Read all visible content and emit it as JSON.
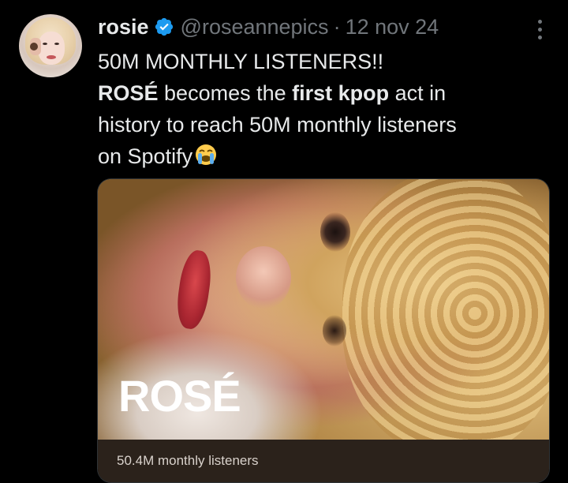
{
  "tweet": {
    "author_name": "rosie",
    "author_handle": "@roseannepics",
    "separator": "·",
    "date": "12 nov 24",
    "verified": true,
    "text_line1": "50M MONTHLY LISTENERS!!",
    "line2_bold1": "ROSÉ",
    "line2_mid": " becomes the ",
    "line2_bold2": "first kpop",
    "line2_end": " act in",
    "line3": "history to reach 50M monthly listeners",
    "line4": "on Spotify",
    "emoji": "loudly-crying-face"
  },
  "media_card": {
    "artist_title": "ROSÉ",
    "caption": "50.4M monthly listeners"
  },
  "colors": {
    "background": "#000000",
    "text_primary": "#e7e9ea",
    "text_secondary": "#71767b",
    "verified_blue": "#1d9bf0",
    "card_caption_bg": "#2b221b"
  }
}
